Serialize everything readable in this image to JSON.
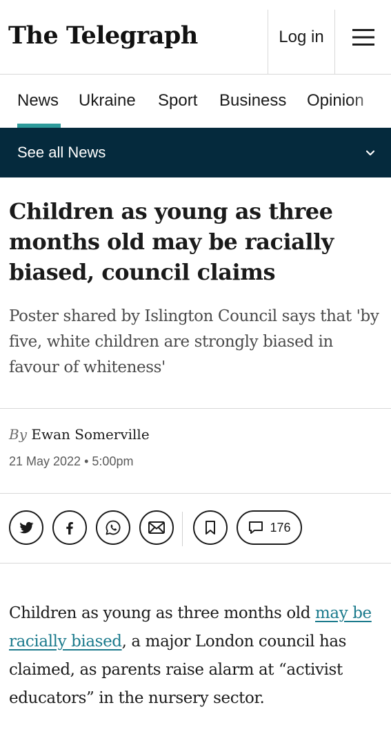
{
  "header": {
    "logo": "The Telegraph",
    "login_label": "Log in",
    "menu_icon": "hamburger-menu-icon"
  },
  "nav": {
    "items": [
      "News",
      "Ukraine",
      "Sport",
      "Business",
      "Opinion"
    ],
    "active": "News",
    "accent_color": "#2e9b9b"
  },
  "section_bar": {
    "label": "See all News",
    "icon": "chevron-down-icon",
    "background": "#052a3d"
  },
  "article": {
    "headline": "Children as young as three months old may be racially biased, council claims",
    "standfirst": "Poster shared by Islington Council says that 'by five, white children are strongly biased in favour of whiteness'",
    "byline_prefix": "By",
    "author": "Ewan Somerville",
    "date": "21 May 2022",
    "separator": "•",
    "time": "5:00pm"
  },
  "share": {
    "buttons": [
      "twitter-icon",
      "facebook-icon",
      "whatsapp-icon",
      "email-icon"
    ],
    "bookmark_icon": "bookmark-icon",
    "comment_icon": "comment-icon",
    "comment_count": "176"
  },
  "body": {
    "para1_before": "Children as young as three months old ",
    "para1_link": "may be racially biased",
    "para1_after": ", a major London council has claimed, as parents raise alarm at “activist educators” in the nursery sector.",
    "link_color": "#1b7a8c"
  }
}
